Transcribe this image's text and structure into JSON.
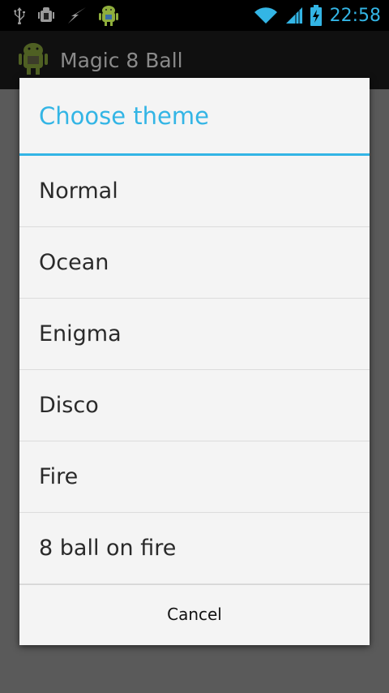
{
  "status_bar": {
    "left_icons": [
      "usb-icon",
      "android-debug-icon",
      "lightning-icon",
      "android-robot-icon"
    ],
    "right_icons": [
      "wifi-icon",
      "signal-icon",
      "battery-charging-icon"
    ],
    "time": "22:58",
    "accent": "#33b5e5"
  },
  "action_bar": {
    "title": "Magic 8 Ball",
    "icon": "android-app-icon"
  },
  "dialog": {
    "title": "Choose theme",
    "options": [
      "Normal",
      "Ocean",
      "Enigma",
      "Disco",
      "Fire",
      "8 ball on fire"
    ],
    "cancel_label": "Cancel"
  }
}
